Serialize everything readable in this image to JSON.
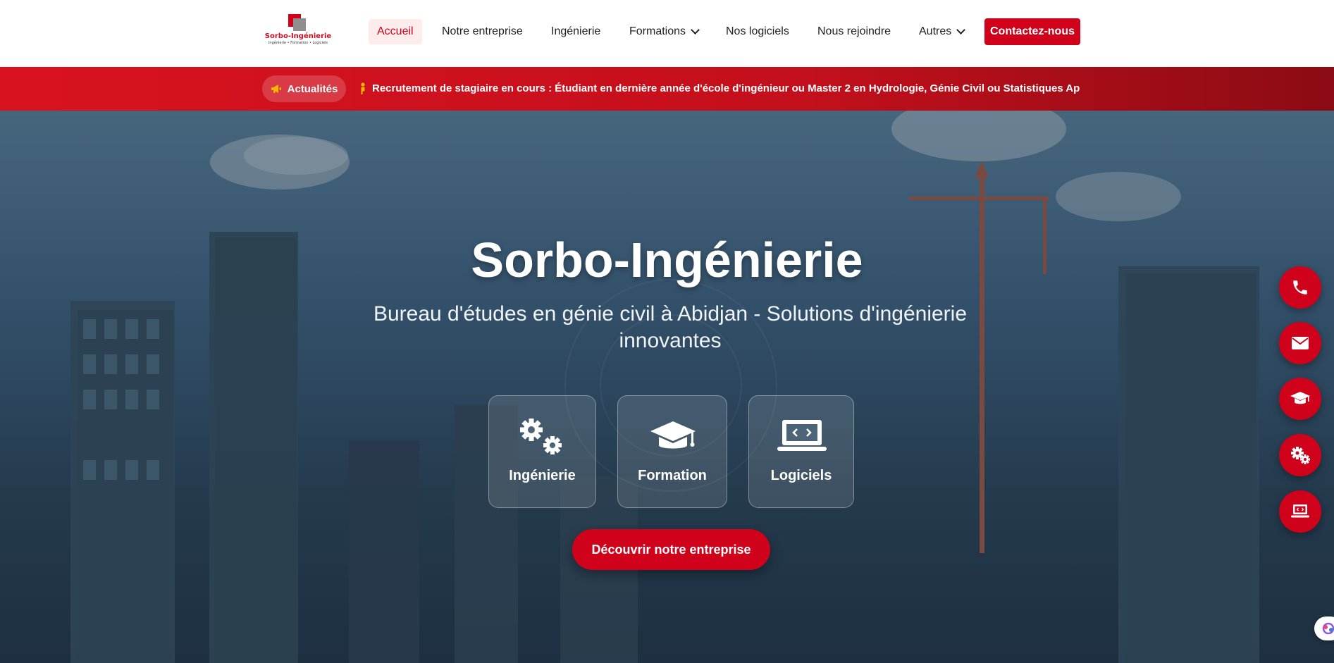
{
  "header": {
    "logo": {
      "name": "Sorbo-Ingénierie",
      "tagline": "Ingénierie • Formation • Logiciels"
    },
    "nav": [
      {
        "label": "Accueil",
        "active": true
      },
      {
        "label": "Notre entreprise"
      },
      {
        "label": "Ingénierie"
      },
      {
        "label": "Formations",
        "dropdown": true
      },
      {
        "label": "Nos logiciels"
      },
      {
        "label": "Nous rejoindre"
      },
      {
        "label": "Autres",
        "dropdown": true
      }
    ],
    "contact_label": "Contactez-nous"
  },
  "ticker": {
    "pill_label": "Actualités",
    "pill_icon": "megaphone-icon",
    "message_icon": "person-icon",
    "message": "Recrutement de stagiaire en cours : Étudiant en dernière année d'école d'ingénieur ou Master 2 en Hydrologie, Génie Civil ou Statistiques Appliquées"
  },
  "hero": {
    "title": "Sorbo-Ingénierie",
    "subtitle": "Bureau d'études en génie civil à Abidjan - Solutions d'ingénierie innovantes",
    "cards": [
      {
        "label": "Ingénierie",
        "icon": "gears-icon"
      },
      {
        "label": "Formation",
        "icon": "graduation-cap-icon"
      },
      {
        "label": "Logiciels",
        "icon": "laptop-code-icon"
      }
    ],
    "cta_label": "Découvrir notre entreprise"
  },
  "floating_actions": [
    {
      "icon": "phone-icon"
    },
    {
      "icon": "envelope-icon"
    },
    {
      "icon": "graduation-cap-icon"
    },
    {
      "icon": "gears-icon"
    },
    {
      "icon": "laptop-code-icon"
    }
  ],
  "colors": {
    "brand_red": "#d0021b",
    "hero_top": "#46667e",
    "hero_bottom": "#1d2f40",
    "ticker_icon": "#f5b800"
  }
}
